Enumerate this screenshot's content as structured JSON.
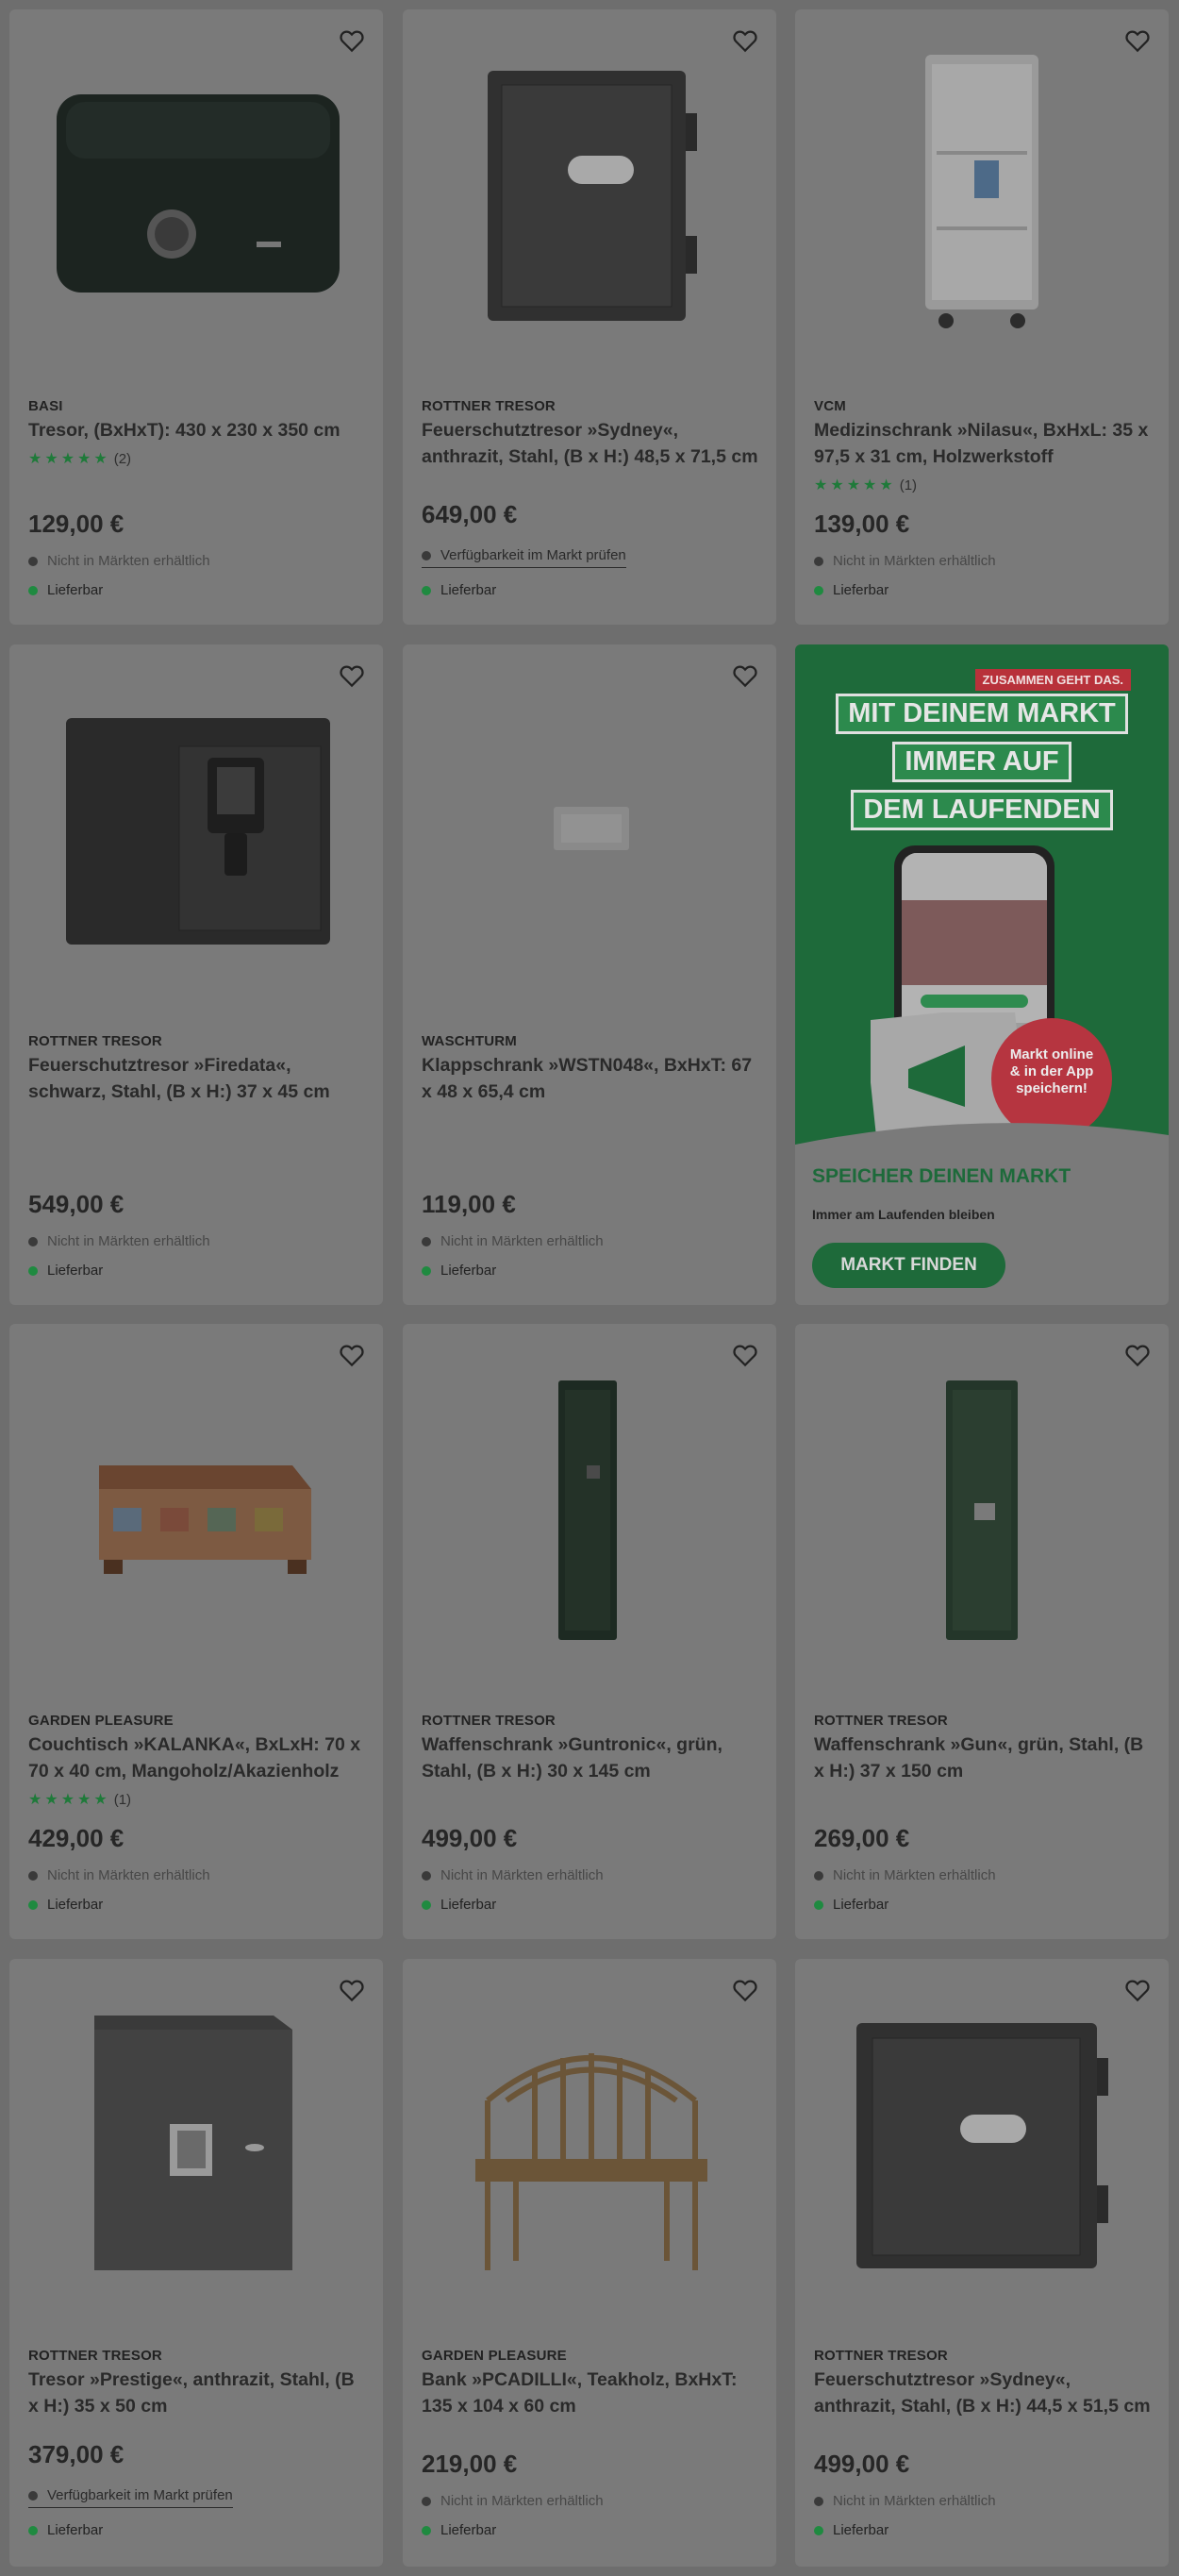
{
  "products": [
    {
      "brand": "BASI",
      "title": "Tresor, (BxHxT): 430 x 230 x 350 cm",
      "rating": "★★★★★",
      "rating_count": "(2)",
      "price": "129,00 €",
      "availability": "Nicht in Märkten erhältlich",
      "delivery": "Lieferbar"
    },
    {
      "brand": "ROTTNER TRESOR",
      "title": "Feuerschutztresor »Sydney«, anthrazit, Stahl, (B x H:) 48,5 x 71,5 cm",
      "price": "649,00 €",
      "availability": "Verfügbarkeit im Markt prüfen",
      "delivery": "Lieferbar"
    },
    {
      "brand": "VCM",
      "title": "Medizinschrank »Nilasu«, BxHxL: 35 x 97,5 x 31 cm, Holzwerkstoff",
      "rating": "★★★★★",
      "rating_count": "(1)",
      "price": "139,00 €",
      "availability": "Nicht in Märkten erhältlich",
      "delivery": "Lieferbar"
    },
    {
      "brand": "ROTTNER TRESOR",
      "title": "Feuerschutztresor »Firedata«, schwarz, Stahl, (B x H:) 37 x 45 cm",
      "price": "549,00 €",
      "availability": "Nicht in Märkten erhältlich",
      "delivery": "Lieferbar"
    },
    {
      "brand": "WASCHTURM",
      "title": "Klappschrank »WSTN048«, BxHxT: 67 x 48 x 65,4 cm",
      "price": "119,00 €",
      "availability": "Nicht in Märkten erhältlich",
      "delivery": "Lieferbar"
    },
    {
      "brand": "GARDEN PLEASURE",
      "title": "Couchtisch »KALANKA«, BxLxH: 70 x 70 x 40 cm, Mangoholz/Akazienholz",
      "rating": "★★★★★",
      "rating_count": "(1)",
      "price": "429,00 €",
      "availability": "Nicht in Märkten erhältlich",
      "delivery": "Lieferbar"
    },
    {
      "brand": "ROTTNER TRESOR",
      "title": "Waffenschrank »Guntronic«, grün, Stahl, (B x H:) 30 x 145 cm",
      "price": "499,00 €",
      "availability": "Nicht in Märkten erhältlich",
      "delivery": "Lieferbar"
    },
    {
      "brand": "ROTTNER TRESOR",
      "title": "Waffenschrank »Gun«, grün, Stahl, (B x H:) 37 x 150 cm",
      "price": "269,00 €",
      "availability": "Nicht in Märkten erhältlich",
      "delivery": "Lieferbar"
    },
    {
      "brand": "ROTTNER TRESOR",
      "title": "Tresor »Prestige«, anthrazit, Stahl, (B x H:) 35 x 50 cm",
      "price": "379,00 €",
      "availability": "Verfügbarkeit im Markt prüfen",
      "delivery": "Lieferbar"
    },
    {
      "brand": "GARDEN PLEASURE",
      "title": "Bank »PCADILLI«, Teakholz, BxHxT: 135 x 104 x 60 cm",
      "price": "219,00 €",
      "availability": "Nicht in Märkten erhältlich",
      "delivery": "Lieferbar"
    },
    {
      "brand": "ROTTNER TRESOR",
      "title": "Feuerschutztresor »Sydney«, anthrazit, Stahl, (B x H:) 44,5 x 51,5 cm",
      "price": "499,00 €",
      "availability": "Nicht in Märkten erhältlich",
      "delivery": "Lieferbar"
    }
  ],
  "promo": {
    "tag": "ZUSAMMEN GEHT DAS.",
    "headline_1": "MIT DEINEM MARKT",
    "headline_2": "IMMER AUF",
    "headline_3": "DEM LAUFENDEN",
    "circle_1": "Markt online",
    "circle_2": "& in der App",
    "circle_3": "speichern!",
    "cta_heading": "SPEICHER DEINEN MARKT",
    "cta_sub": "Immer am Laufenden bleiben",
    "button": "MARKT FINDEN"
  },
  "icons": {
    "favorite": "heart-icon"
  },
  "colors": {
    "rating_star": "#1f7a3a",
    "delivery_dot": "#1f8a40",
    "promo_green": "#1e6a3a",
    "promo_red": "#b63540"
  }
}
